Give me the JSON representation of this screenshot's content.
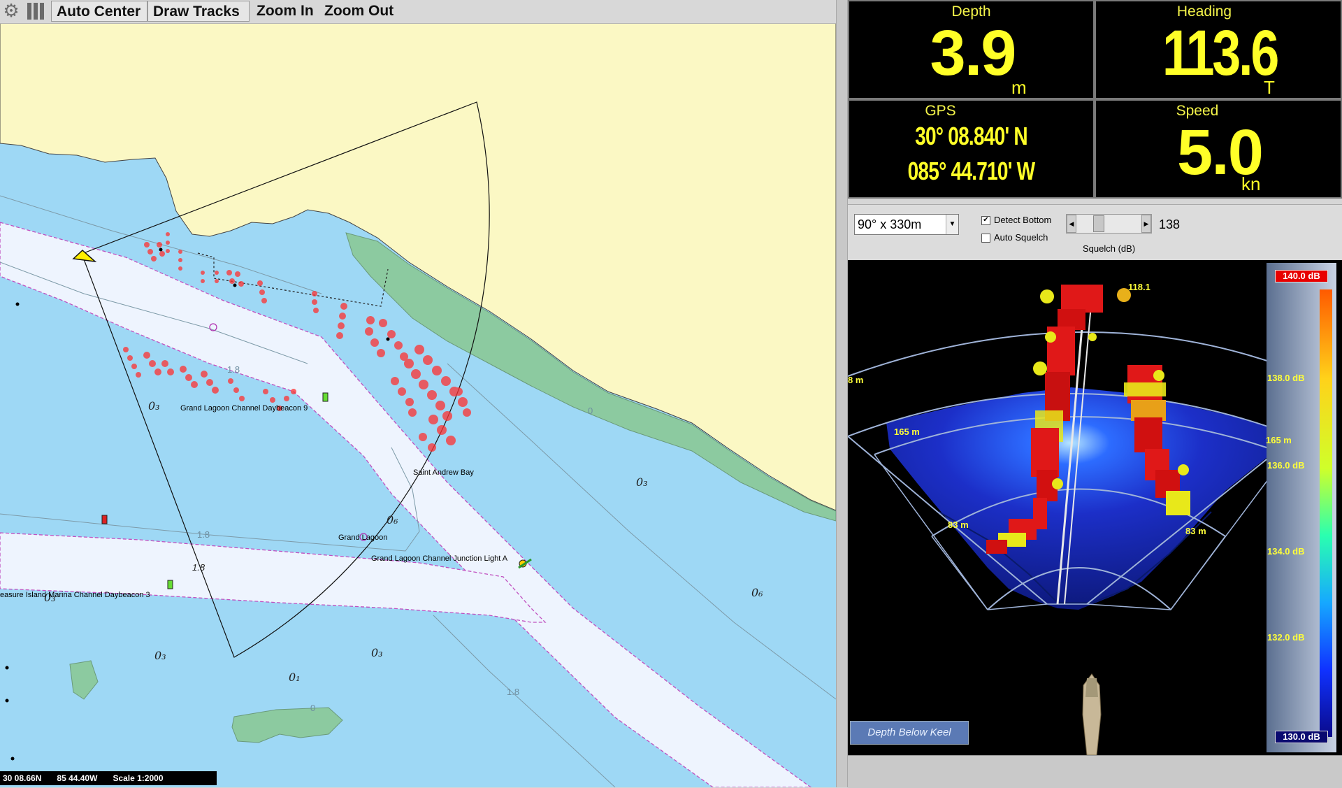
{
  "toolbar": {
    "settings_icon": "gear-icon",
    "layers_icon": "columns-icon",
    "auto_center": "Auto Center",
    "draw_tracks": "Draw Tracks",
    "zoom_in": "Zoom In",
    "zoom_out": "Zoom Out"
  },
  "map": {
    "labels": {
      "daybeacon9": "Grand Lagoon Channel Daybeacon 9",
      "saint_andrew_bay": "Saint Andrew Bay",
      "grand_lagoon": "Grand Lagoon",
      "junction_light": "Grand Lagoon Channel Junction Light A",
      "marina_daybeacon3": "easure Island Marina Channel Daybeacon 3"
    },
    "soundings": {
      "s1": "0₃",
      "s2": "0₃",
      "s3": "0₆",
      "s4": "0₃",
      "s5": "0₆",
      "s6": "0₃",
      "s7": "0₃",
      "s8": "0₁"
    },
    "contours": {
      "c1": "1.8",
      "c2": "0",
      "c3": "1.8",
      "c4": "1.8",
      "c5": "1.8",
      "c6": "0"
    }
  },
  "status": {
    "lat": "30 08.66N",
    "lon": "85 44.40W",
    "scale": "Scale 1:2000"
  },
  "instruments": {
    "depth": {
      "label": "Depth",
      "value": "3.9",
      "unit": "m"
    },
    "heading": {
      "label": "Heading",
      "value": "113.6",
      "unit": "T"
    },
    "gps": {
      "label": "GPS",
      "lat": "30° 08.840' N",
      "lon": "085° 44.710' W"
    },
    "speed": {
      "label": "Speed",
      "value": "5.0",
      "unit": "kn"
    }
  },
  "controls": {
    "range_select": "90° x 330m",
    "detect_bottom": "Detect Bottom",
    "detect_bottom_checked": true,
    "auto_squelch": "Auto Squelch",
    "auto_squelch_checked": false,
    "squelch_value": "138",
    "squelch_label": "Squelch (dB)",
    "squelch_level_fraction": 0.3
  },
  "sonar": {
    "ranges": {
      "r8": "8 m",
      "r165_left": "165 m",
      "r165_right": "165 m",
      "r83_left": "83 m",
      "r83_right": "83 m",
      "depth_peak": "118.1"
    },
    "colorbar": {
      "top": "140.0 dB",
      "t138": "138.0 dB",
      "t136": "136.0 dB",
      "t134": "134.0 dB",
      "t132": "132.0 dB",
      "bottom": "130.0 dB"
    },
    "mode_button": "Depth Below Keel"
  },
  "colors": {
    "land": "#fbf8c4",
    "water": "#9ed8f5",
    "channel": "#eef4fe",
    "shoal": "#8ccaa0",
    "instrument_text": "#ffff28",
    "sonar_target": "#ff2020"
  }
}
